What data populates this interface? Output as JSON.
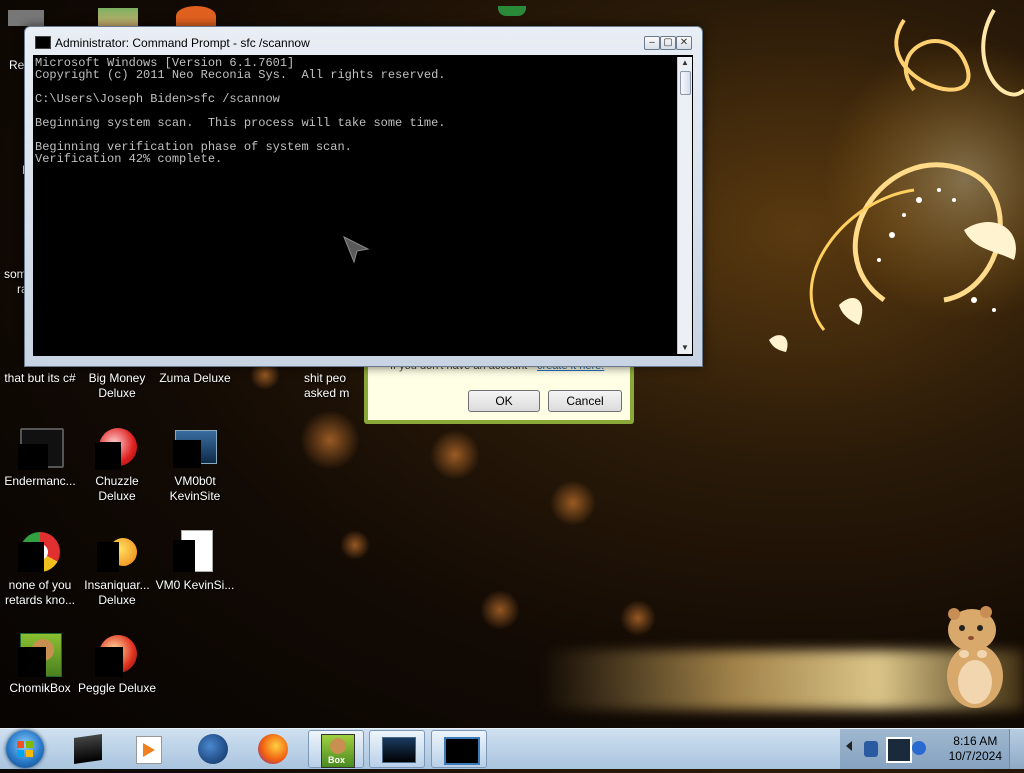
{
  "window": {
    "title": "Administrator: Command Prompt - sfc  /scannow",
    "console_text": "Microsoft Windows [Version 6.1.7601]\nCopyright (c) 2011 Neo Reconia Sys.  All rights reserved.\n\nC:\\Users\\Joseph Biden>sfc /scannow\n\nBeginning system scan.  This process will take some time.\n\nBeginning verification phase of system scan.\nVerification 42% complete.",
    "buttons": {
      "minimize": "–",
      "maximize": "▢",
      "close": "✕"
    }
  },
  "dialog": {
    "message": "If you don't have an account - ",
    "link": "create it here!",
    "ok_label": "OK",
    "cancel_label": "Cancel"
  },
  "desktop": {
    "partial_labels": [
      "Rec",
      "F",
      "som",
      "ra"
    ],
    "icons": [
      {
        "label": "that but its c#",
        "icon": "app-icon"
      },
      {
        "label": "Big Money Deluxe",
        "icon": "popcap-game-icon"
      },
      {
        "label": "Zuma Deluxe",
        "icon": "game-icon"
      },
      {
        "label": "shit peo asked m",
        "icon": "file-icon"
      },
      {
        "label": "Endermanc...",
        "icon": "monitor-icon"
      },
      {
        "label": "Chuzzle Deluxe",
        "icon": "popcap-game-icon"
      },
      {
        "label": "VM0b0t KevinSite",
        "icon": "window-icon"
      },
      {
        "label": "none of you retards kno...",
        "icon": "browser-icon"
      },
      {
        "label": "Insaniquar... Deluxe",
        "icon": "fish-game-icon"
      },
      {
        "label": "VM0 KevinSi...",
        "icon": "document-icon"
      },
      {
        "label": "ChomikBox",
        "icon": "hamster-app-icon"
      },
      {
        "label": "Peggle Deluxe",
        "icon": "popcap-game-icon"
      }
    ]
  },
  "taskbar": {
    "items": [
      "app-icon",
      "media-player-icon",
      "browser-globe-icon",
      "firefox-icon",
      "chomikbox-icon",
      "window-icon",
      "command-prompt-icon"
    ],
    "chomik_label": "Box",
    "time": "8:16 AM",
    "date": "10/7/2024"
  },
  "colors": {
    "console_bg": "#000000",
    "console_text": "#c0c0c0",
    "dialog_bg": "#ffffe6",
    "taskbar": "#b8d0e8"
  }
}
